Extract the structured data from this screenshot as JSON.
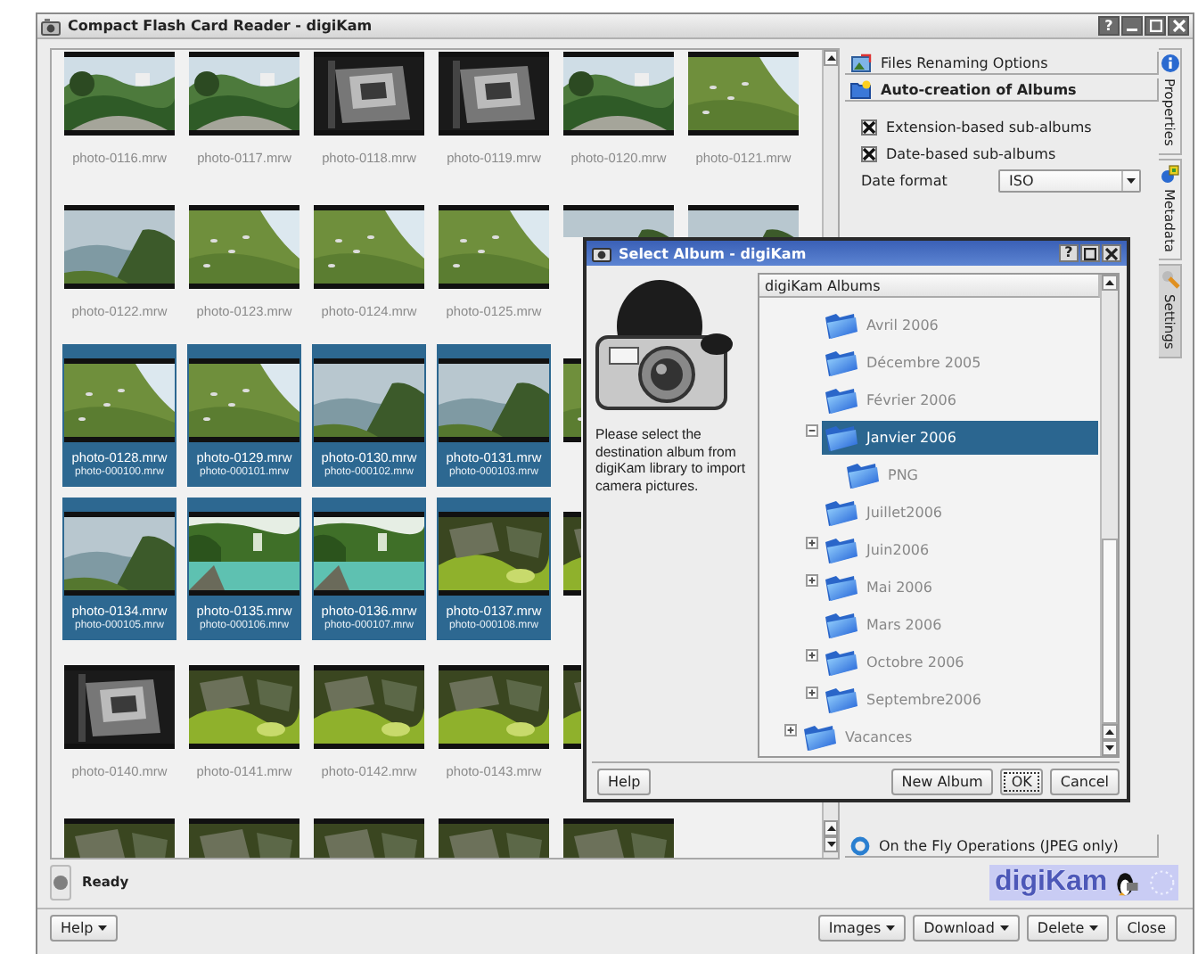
{
  "window": {
    "title": "Compact Flash Card Reader - digiKam",
    "title_buttons": [
      {
        "kind": "help",
        "glyph": "?"
      },
      {
        "kind": "minimize"
      },
      {
        "kind": "maximize"
      },
      {
        "kind": "close"
      }
    ]
  },
  "thumbnail_rows": [
    [
      {
        "label": "photo-0116.mrw",
        "selected": false
      },
      {
        "label": "photo-0117.mrw",
        "selected": false
      },
      {
        "label": "photo-0118.mrw",
        "selected": false
      },
      {
        "label": "photo-0119.mrw",
        "selected": false
      },
      {
        "label": "photo-0120.mrw",
        "selected": false
      },
      {
        "label": "photo-0121.mrw",
        "selected": false
      }
    ],
    [
      {
        "label": "photo-0122.mrw",
        "selected": false
      },
      {
        "label": "photo-0123.mrw",
        "selected": false
      },
      {
        "label": "photo-0124.mrw",
        "selected": false
      },
      {
        "label": "photo-0125.mrw",
        "selected": false
      },
      {
        "selected": false
      },
      {
        "selected": false
      }
    ],
    [
      {
        "label": "photo-0128.mrw",
        "sublabel": "photo-000100.mrw",
        "selected": true
      },
      {
        "label": "photo-0129.mrw",
        "sublabel": "photo-000101.mrw",
        "selected": true
      },
      {
        "label": "photo-0130.mrw",
        "sublabel": "photo-000102.mrw",
        "selected": true
      },
      {
        "label": "photo-0131.mrw",
        "sublabel": "photo-000103.mrw",
        "selected": true
      },
      {
        "selected": false
      }
    ],
    [
      {
        "label": "photo-0134.mrw",
        "sublabel": "photo-000105.mrw",
        "selected": true
      },
      {
        "label": "photo-0135.mrw",
        "sublabel": "photo-000106.mrw",
        "selected": true
      },
      {
        "label": "photo-0136.mrw",
        "sublabel": "photo-000107.mrw",
        "selected": true
      },
      {
        "label": "photo-0137.mrw",
        "sublabel": "photo-000108.mrw",
        "selected": true
      },
      {
        "selected": false
      }
    ],
    [
      {
        "label": "photo-0140.mrw",
        "selected": false
      },
      {
        "label": "photo-0141.mrw",
        "selected": false
      },
      {
        "label": "photo-0142.mrw",
        "selected": false
      },
      {
        "label": "photo-0143.mrw",
        "selected": false
      },
      {
        "selected": false
      }
    ],
    [
      {
        "selected": false
      },
      {
        "selected": false
      },
      {
        "selected": false
      },
      {
        "selected": false
      },
      {
        "selected": false
      }
    ]
  ],
  "settings_panel": {
    "sections": [
      {
        "title": "Files Renaming Options",
        "expanded": false
      },
      {
        "title": "Auto-creation of Albums",
        "expanded": true
      },
      {
        "title": "On the Fly Operations (JPEG only)",
        "expanded": false
      }
    ],
    "options": [
      {
        "label": "Extension-based sub-albums",
        "checked": true
      },
      {
        "label": "Date-based sub-albums",
        "checked": true
      }
    ],
    "date_format": {
      "label": "Date format",
      "value": "ISO"
    }
  },
  "side_tabs": [
    {
      "label": "Properties",
      "selected": false
    },
    {
      "label": "Metadata",
      "selected": false
    },
    {
      "label": "Settings",
      "selected": true
    }
  ],
  "status_bar": {
    "text": "Ready"
  },
  "logo": {
    "text": "digiKam"
  },
  "buttons_left": [
    {
      "label": "Help",
      "menu": true
    }
  ],
  "buttons_right": [
    {
      "label": "Images",
      "menu": true
    },
    {
      "label": "Download",
      "menu": true
    },
    {
      "label": "Delete",
      "menu": true
    },
    {
      "label": "Close",
      "menu": false
    }
  ],
  "dialog": {
    "title": "Select Album - digiKam",
    "title_buttons": [
      {
        "kind": "help",
        "glyph": "?"
      },
      {
        "kind": "maximize"
      },
      {
        "kind": "close"
      }
    ],
    "message": "Please select the destination album from digiKam library to import camera pictures.",
    "tree": {
      "header": "digiKam Albums",
      "items": [
        {
          "children": [
            {
              "label": "Avril 2006",
              "selected": false
            },
            {
              "label": "Décembre 2005",
              "selected": false
            },
            {
              "label": "Février 2006",
              "selected": false
            },
            {
              "label": "Janvier 2006",
              "selected": true,
              "expanded": true,
              "children": [
                {
                  "label": "PNG",
                  "selected": false
                }
              ]
            },
            {
              "label": "Juillet2006",
              "selected": false
            },
            {
              "label": "Juin2006",
              "selected": false,
              "expanded": false
            },
            {
              "label": "Mai 2006",
              "selected": false,
              "expanded": false
            },
            {
              "label": "Mars 2006",
              "selected": false
            },
            {
              "label": "Octobre 2006",
              "selected": false,
              "expanded": false
            },
            {
              "label": "Septembre2006",
              "selected": false,
              "expanded": false
            }
          ]
        },
        {
          "label": "Vacances",
          "selected": false,
          "expanded": false
        }
      ]
    },
    "help_button": "Help",
    "buttons": [
      {
        "label": "New Album",
        "focused": false
      },
      {
        "label": "OK",
        "focused": true
      },
      {
        "label": "Cancel",
        "focused": false
      }
    ]
  }
}
